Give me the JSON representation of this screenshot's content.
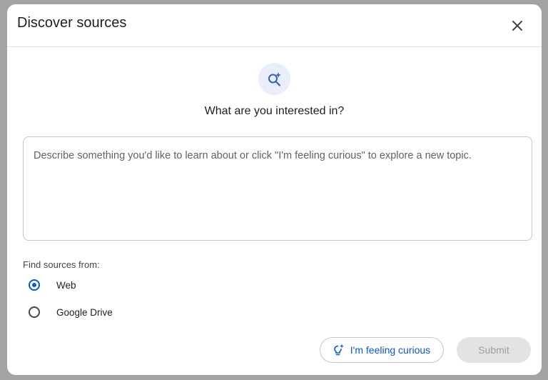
{
  "dialog": {
    "title": "Discover sources",
    "close_icon": "close-icon"
  },
  "main": {
    "hero_icon": "search-sparkle-icon",
    "question": "What are you interested in?",
    "textarea_placeholder": "Describe something you'd like to learn about or click \"I'm feeling curious\" to explore a new topic.",
    "textarea_value": ""
  },
  "sources": {
    "label": "Find sources from:",
    "options": [
      {
        "label": "Web",
        "selected": true
      },
      {
        "label": "Google Drive",
        "selected": false
      }
    ]
  },
  "footer": {
    "curious_icon": "lightbulb-sparkle-icon",
    "curious_label": "I'm feeling curious",
    "submit_label": "Submit"
  },
  "colors": {
    "accent": "#0b57d0",
    "hero_bg": "#e8eefa",
    "disabled_bg": "#e3e3e3",
    "disabled_text": "#9e9e9e"
  }
}
